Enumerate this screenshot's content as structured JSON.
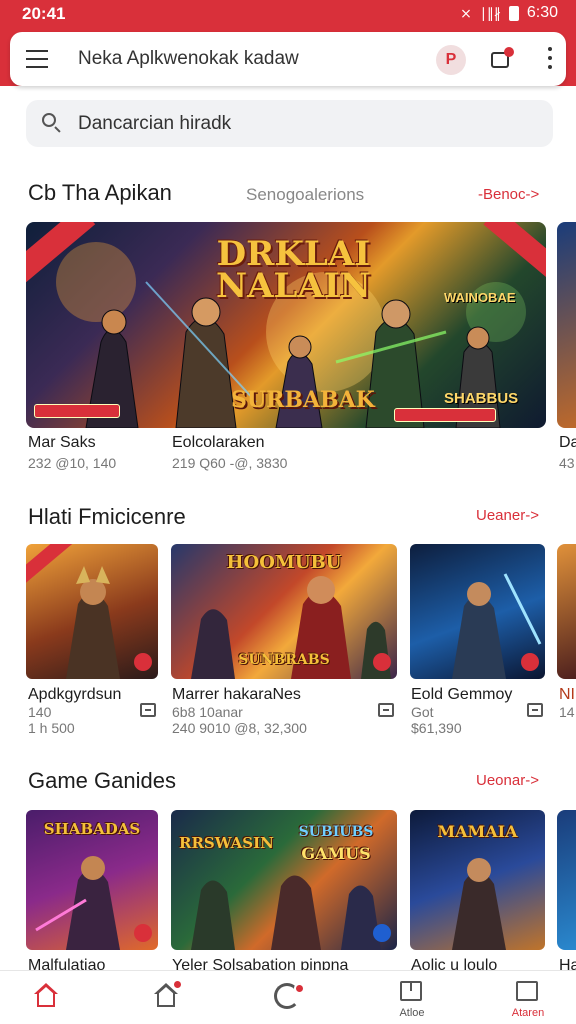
{
  "status_bar": {
    "time": "20:41",
    "right_time": "6:30",
    "signal": "∣∥∦",
    "wifi": "⨯"
  },
  "app_bar": {
    "title": "Neka Aplkwenokak kadaw",
    "avatar_letter": "P"
  },
  "search": {
    "placeholder": "Dancarcian hiradk"
  },
  "featured": {
    "title": "Cb Tha Apikan",
    "subtitle": "Senogoalerions",
    "link": "-Benoc->",
    "banner": {
      "title_line1": "DRKLAI",
      "title_line2": "NALAIN",
      "subtitle": "SURBABAK",
      "side_label": "WAINOBAE",
      "side_label2": "SHABBUS"
    },
    "items": [
      {
        "name": "Mar Saks",
        "meta": "232 @10, 140"
      },
      {
        "name": "Eolcolaraken",
        "meta": "219 Q60 -@, 3830"
      },
      {
        "name": "Da",
        "meta": "43"
      }
    ]
  },
  "section2": {
    "title": "Hlati Fmicicenre",
    "link": "Ueaner->",
    "cards": [
      {
        "name": "Apdkgyrdsun",
        "meta1": "140",
        "meta2": "1 h 500",
        "art": ""
      },
      {
        "name": "Marrer hakaraNes",
        "meta1": "6b8 10anar",
        "meta2": "240 9010 @8, 32,300",
        "art": "HOOMUBU",
        "art2": "SUNBRABS"
      },
      {
        "name": "Eold Gemmoy",
        "meta1": "Got",
        "meta2": "$61,390",
        "art": ""
      },
      {
        "name": "NI",
        "meta1": "14",
        "meta2": ""
      }
    ]
  },
  "section3": {
    "title": "Game Ganides",
    "link": "Ueonar->",
    "cards": [
      {
        "name": "Malfulatiao",
        "art": "SHABADAS"
      },
      {
        "name": "Yeler Solsabation pinpna",
        "art": "RRSWASIN",
        "art2": "SUBIUBS",
        "art3": "GAMUS"
      },
      {
        "name": "Aolic u loulo",
        "art": "MAMAIA"
      },
      {
        "name": "Ha",
        "art": ""
      }
    ]
  },
  "bottom_nav": {
    "items": [
      {
        "label": "",
        "icon": "home-icon",
        "active": true
      },
      {
        "label": "",
        "icon": "home-badge-icon"
      },
      {
        "label": "",
        "icon": "refresh-icon"
      },
      {
        "label": "Atloe",
        "icon": "box-icon"
      },
      {
        "label": "Ataren",
        "icon": "chart-icon",
        "active": true
      }
    ]
  },
  "colors": {
    "accent": "#d9303a",
    "background": "#ffffff",
    "search_bg": "#f1f2f4"
  }
}
